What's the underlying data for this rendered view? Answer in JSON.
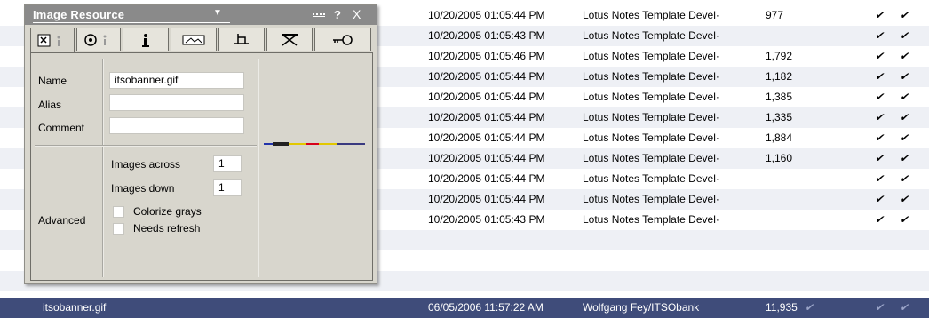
{
  "panel": {
    "title": "Image Resource",
    "help_label": "?",
    "close_label": "X",
    "tabs": [
      "basics",
      "hide-when",
      "info",
      "image",
      "layout",
      "design",
      "security"
    ],
    "fields": {
      "name_label": "Name",
      "name_value": "itsobanner.gif",
      "alias_label": "Alias",
      "alias_value": "",
      "comment_label": "Comment",
      "comment_value": ""
    },
    "advanced": {
      "section_label": "Advanced",
      "images_across_label": "Images across",
      "images_across_value": "1",
      "images_down_label": "Images down",
      "images_down_value": "1",
      "colorize_grays_label": "Colorize grays",
      "needs_refresh_label": "Needs refresh"
    }
  },
  "rows": [
    {
      "date": "10/20/2005 01:05:44 PM",
      "author": "Lotus Notes Template Devel·",
      "size": "977",
      "check1": "✔",
      "check2": "✔"
    },
    {
      "date": "10/20/2005 01:05:43 PM",
      "author": "Lotus Notes Template Devel·",
      "size": "",
      "check1": "✔",
      "check2": "✔"
    },
    {
      "date": "10/20/2005 01:05:46 PM",
      "author": "Lotus Notes Template Devel·",
      "size": "1,792",
      "check1": "✔",
      "check2": "✔"
    },
    {
      "date": "10/20/2005 01:05:44 PM",
      "author": "Lotus Notes Template Devel·",
      "size": "1,182",
      "check1": "✔",
      "check2": "✔"
    },
    {
      "date": "10/20/2005 01:05:44 PM",
      "author": "Lotus Notes Template Devel·",
      "size": "1,385",
      "check1": "✔",
      "check2": "✔"
    },
    {
      "date": "10/20/2005 01:05:44 PM",
      "author": "Lotus Notes Template Devel·",
      "size": "1,335",
      "check1": "✔",
      "check2": "✔"
    },
    {
      "date": "10/20/2005 01:05:44 PM",
      "author": "Lotus Notes Template Devel·",
      "size": "1,884",
      "check1": "✔",
      "check2": "✔"
    },
    {
      "date": "10/20/2005 01:05:44 PM",
      "author": "Lotus Notes Template Devel·",
      "size": "1,160",
      "check1": "✔",
      "check2": "✔"
    },
    {
      "date": "10/20/2005 01:05:44 PM",
      "author": "Lotus Notes Template Devel·",
      "size": "",
      "check1": "✔",
      "check2": "✔"
    },
    {
      "date": "10/20/2005 01:05:44 PM",
      "author": "Lotus Notes Template Devel·",
      "size": "",
      "check1": "✔",
      "check2": "✔"
    },
    {
      "date": "10/20/2005 01:05:43 PM",
      "author": "Lotus Notes Template Devel·",
      "size": "",
      "check1": "✔",
      "check2": "✔"
    }
  ],
  "selected_row": {
    "name": "itsobanner.gif",
    "date": "06/05/2006 11:57:22 AM",
    "author": "Wolfgang Fey/ITSObank",
    "size": "11,935",
    "check0": "✔",
    "check1": "✔",
    "check2": "✔"
  },
  "colors": {
    "selection": "#3f4c7a",
    "alt_row": "#eef0f5",
    "panel_bg": "#d8d6cd",
    "titlebar": "#8a8a8a"
  }
}
